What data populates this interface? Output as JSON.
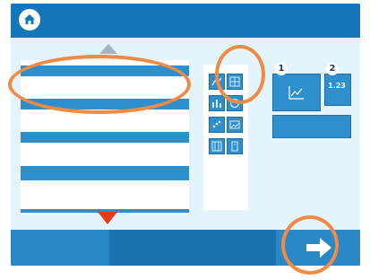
{
  "app": {
    "theme_color": "#1577b8",
    "accent_color": "#2f8fcc",
    "highlight_color": "#f08a44"
  },
  "header": {
    "home_icon": "home-icon"
  },
  "list": {
    "scroll_up_icon": "triangle-up-icon",
    "scroll_down_icon": "triangle-down-icon",
    "rows": 7
  },
  "tool_panel": {
    "icons": [
      "line-chart-icon",
      "grid-icon",
      "bar-chart-icon",
      "circle-chart-icon",
      "scatter-icon",
      "image-icon",
      "table-icon",
      "text-icon"
    ]
  },
  "slots": [
    {
      "badge": "1",
      "icon": "line-chart-icon"
    },
    {
      "badge": "2",
      "label": "1.23"
    }
  ],
  "footer": {
    "next_icon": "arrow-right-icon"
  }
}
